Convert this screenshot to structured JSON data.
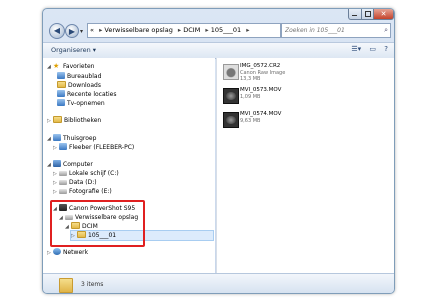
{
  "window": {
    "address": {
      "crumbs": [
        "Verwisselbare opslag",
        "DCIM",
        "105___01"
      ],
      "separator": "▸"
    },
    "search": {
      "placeholder": "Zoeken in 105___01"
    },
    "toolbar": {
      "organize": "Organiseren ▾"
    },
    "nav": {
      "favorites": {
        "label": "Favorieten",
        "items": [
          "Bureaublad",
          "Downloads",
          "Recente locaties",
          "Tv-opnemen"
        ]
      },
      "libraries": "Bibliotheken",
      "homegroup": {
        "label": "Thuisgroep",
        "items": [
          "Fleeber (FLEEBER-PC)"
        ]
      },
      "computer": {
        "label": "Computer",
        "items": [
          "Lokale schijf (C:)",
          "Data (D:)",
          "Fotografie (E:)"
        ]
      },
      "camera": {
        "label": "Canon PowerShot S95",
        "storage": "Verwisselbare opslag",
        "dcim": "DCIM",
        "folder": "105___01"
      },
      "network": "Netwerk"
    },
    "files": [
      {
        "name": "IMG_0572.CR2",
        "type": "Canon Raw Image",
        "size": "13,3 MB",
        "kind": "raw"
      },
      {
        "name": "MVI_0573.MOV",
        "type": "",
        "size": "1,09 MB",
        "kind": "video"
      },
      {
        "name": "MVI_0574.MOV",
        "type": "",
        "size": "9,63 MB",
        "kind": "video"
      }
    ],
    "status": {
      "count": "3 items"
    }
  }
}
